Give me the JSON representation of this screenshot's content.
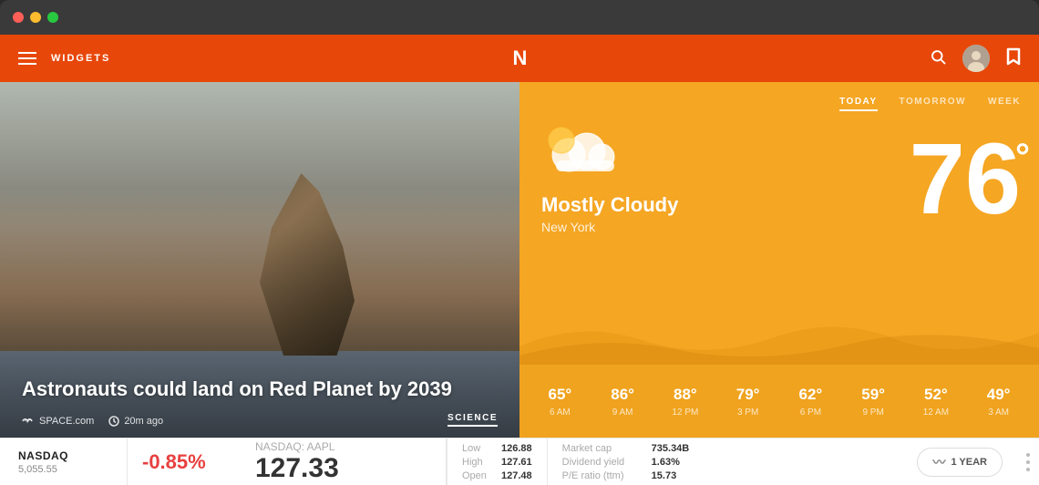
{
  "titlebar": {
    "traffic_lights": [
      "red",
      "yellow",
      "green"
    ]
  },
  "navbar": {
    "brand": "WIDGETS",
    "logo": "N",
    "search_icon": "🔍",
    "bookmark_icon": "🔖"
  },
  "news": {
    "headline": "Astronauts could land on Red Planet by 2039",
    "source": "SPACE.com",
    "time": "20m ago",
    "category": "SCIENCE"
  },
  "weather": {
    "tabs": [
      "TODAY",
      "TOMORROW",
      "WEEK"
    ],
    "active_tab": "TODAY",
    "condition": "Mostly Cloudy",
    "city": "New York",
    "temperature": "76",
    "degree_symbol": "°",
    "hourly": [
      {
        "temp": "65°",
        "label": "6 AM"
      },
      {
        "temp": "86°",
        "label": "9 AM"
      },
      {
        "temp": "88°",
        "label": "12 PM"
      },
      {
        "temp": "79°",
        "label": "3 PM"
      },
      {
        "temp": "62°",
        "label": "6 PM"
      },
      {
        "temp": "59°",
        "label": "9 PM"
      },
      {
        "temp": "52°",
        "label": "12 AM"
      },
      {
        "temp": "49°",
        "label": "3 AM"
      }
    ]
  },
  "ticker": {
    "nasdaq_label": "NASDAQ",
    "nasdaq_value": "5,055.55",
    "nasdaq_change": "-0.85%",
    "aapl_label": "NASDAQ: AAPL",
    "aapl_price": "127.33",
    "stats_left": [
      {
        "key": "Low",
        "val": "126.88"
      },
      {
        "key": "High",
        "val": "127.61"
      },
      {
        "key": "Open",
        "val": "127.48"
      }
    ],
    "stats_right": [
      {
        "key": "Market cap",
        "val": "735.34B"
      },
      {
        "key": "Dividend yield",
        "val": "1.63%"
      },
      {
        "key": "P/E ratio (ttm)",
        "val": "15.73"
      }
    ],
    "chart_period": "1 YEAR"
  }
}
